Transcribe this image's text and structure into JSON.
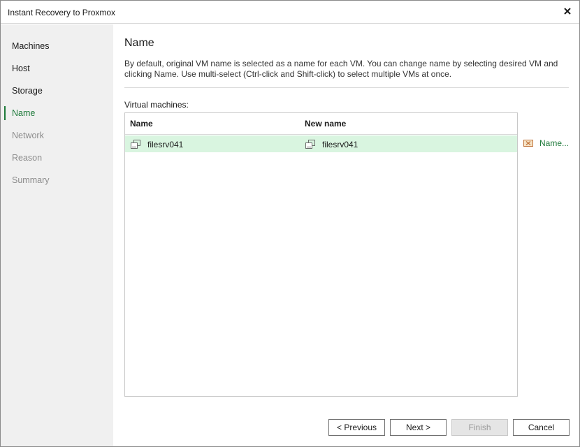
{
  "window": {
    "title": "Instant Recovery to Proxmox"
  },
  "sidebar": {
    "steps": [
      {
        "label": "Machines",
        "state": "done"
      },
      {
        "label": "Host",
        "state": "done"
      },
      {
        "label": "Storage",
        "state": "done"
      },
      {
        "label": "Name",
        "state": "current"
      },
      {
        "label": "Network",
        "state": "future"
      },
      {
        "label": "Reason",
        "state": "future"
      },
      {
        "label": "Summary",
        "state": "future"
      }
    ]
  },
  "main": {
    "title": "Name",
    "description": "By default, original VM name is selected as a name for each VM. You can change name by selecting desired VM and clicking Name. Use multi-select (Ctrl-click and Shift-click) to select multiple VMs at once.",
    "vm_label": "Virtual machines:",
    "table": {
      "columns": [
        "Name",
        "New name"
      ],
      "rows": [
        {
          "name": "filesrv041",
          "new_name": "filesrv041",
          "icon": "vm-icon",
          "selected": true
        }
      ]
    },
    "name_action": {
      "label": "Name...",
      "icon": "rename-icon"
    }
  },
  "footer": {
    "previous": "< Previous",
    "next": "Next >",
    "finish": "Finish",
    "cancel": "Cancel"
  },
  "colors": {
    "accent": "#1e7a3a",
    "selected_row": "#d9f5e0",
    "sidebar_bg": "#f0f0f0",
    "disabled_text": "#8c8c8c"
  }
}
